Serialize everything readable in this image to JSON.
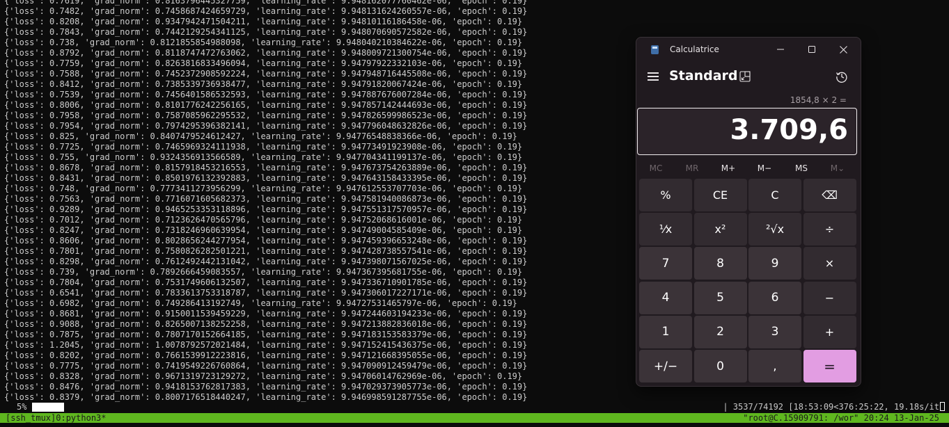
{
  "terminal": {
    "log_lines": [
      "{'loss': 0.7619, 'grad_norm': 0.8163796445327759, 'learning_rate': 9.948162077760462e-06, 'epoch': 0.19}",
      "{'loss': 0.7482, 'grad_norm': 0.7458687424659729, 'learning_rate': 9.948131624260557e-06, 'epoch': 0.19}",
      "{'loss': 0.8208, 'grad_norm': 0.9347942471504211, 'learning_rate': 9.94810116186458e-06, 'epoch': 0.19}",
      "{'loss': 0.7843, 'grad_norm': 0.7442129254341125, 'learning_rate': 9.948070690572582e-06, 'epoch': 0.19}",
      "{'loss': 0.738, 'grad_norm': 0.8121855854988098, 'learning_rate': 9.948040210384622e-06, 'epoch': 0.19}",
      "{'loss': 0.8792, 'grad_norm': 0.8118747472763062, 'learning_rate': 9.948009721300754e-06, 'epoch': 0.19}",
      "{'loss': 0.7759, 'grad_norm': 0.8263816833496094, 'learning_rate': 9.94797922332103e-06, 'epoch': 0.19}",
      "{'loss': 0.7588, 'grad_norm': 0.7452372908592224, 'learning_rate': 9.947948716445508e-06, 'epoch': 0.19}",
      "{'loss': 0.8412, 'grad_norm': 0.7385339736938477, 'learning_rate': 9.94791820067424e-06, 'epoch': 0.19}",
      "{'loss': 0.7539, 'grad_norm': 0.7456401586532593, 'learning_rate': 9.947887676007284e-06, 'epoch': 0.19}",
      "{'loss': 0.8006, 'grad_norm': 0.8101776242256165, 'learning_rate': 9.947857142444693e-06, 'epoch': 0.19}",
      "{'loss': 0.7958, 'grad_norm': 0.7587085962295532, 'learning_rate': 9.947826599986523e-06, 'epoch': 0.19}",
      "{'loss': 0.7954, 'grad_norm': 0.7974295396382141, 'learning_rate': 9.947796048632826e-06, 'epoch': 0.19}",
      "{'loss': 0.825, 'grad_norm': 0.8407479524612427, 'learning_rate': 9.94776548838366e-06, 'epoch': 0.19}",
      "{'loss': 0.7725, 'grad_norm': 0.7465969324111938, 'learning_rate': 9.94773491923908e-06, 'epoch': 0.19}",
      "{'loss': 0.755, 'grad_norm': 0.9324356913566589, 'learning_rate': 9.947704341199137e-06, 'epoch': 0.19}",
      "{'loss': 0.8678, 'grad_norm': 0.8157918453216553, 'learning_rate': 9.947673754263889e-06, 'epoch': 0.19}",
      "{'loss': 0.8431, 'grad_norm': 0.8501976132392883, 'learning_rate': 9.947643158433395e-06, 'epoch': 0.19}",
      "{'loss': 0.748, 'grad_norm': 0.7773411273956299, 'learning_rate': 9.947612553707703e-06, 'epoch': 0.19}",
      "{'loss': 0.7563, 'grad_norm': 0.7716071605682373, 'learning_rate': 9.947581940086873e-06, 'epoch': 0.19}",
      "{'loss': 0.9289, 'grad_norm': 0.9465253353118896, 'learning_rate': 9.947551317570957e-06, 'epoch': 0.19}",
      "{'loss': 0.7012, 'grad_norm': 0.7123626470565796, 'learning_rate': 9.94752068616001e-06, 'epoch': 0.19}",
      "{'loss': 0.8247, 'grad_norm': 0.7318246960639954, 'learning_rate': 9.94749004585409e-06, 'epoch': 0.19}",
      "{'loss': 0.8606, 'grad_norm': 0.8028656244277954, 'learning_rate': 9.947459396653248e-06, 'epoch': 0.19}",
      "{'loss': 0.7801, 'grad_norm': 0.7580826282501221, 'learning_rate': 9.947428738557541e-06, 'epoch': 0.19}",
      "{'loss': 0.8298, 'grad_norm': 0.7612492442131042, 'learning_rate': 9.947398071567025e-06, 'epoch': 0.19}",
      "{'loss': 0.739, 'grad_norm': 0.7892666459083557, 'learning_rate': 9.947367395681755e-06, 'epoch': 0.19}",
      "{'loss': 0.7804, 'grad_norm': 0.7531749606132507, 'learning_rate': 9.947336710901785e-06, 'epoch': 0.19}",
      "{'loss': 0.6541, 'grad_norm': 0.7833613753318787, 'learning_rate': 9.947306017227171e-06, 'epoch': 0.19}",
      "{'loss': 0.6982, 'grad_norm': 0.749286413192749, 'learning_rate': 9.94727531465797e-06, 'epoch': 0.19}",
      "{'loss': 0.8681, 'grad_norm': 0.9150011539459229, 'learning_rate': 9.947244603194233e-06, 'epoch': 0.19}",
      "{'loss': 0.9088, 'grad_norm': 0.8265007138252258, 'learning_rate': 9.947213882836018e-06, 'epoch': 0.19}",
      "{'loss': 0.7875, 'grad_norm': 0.7807170152664185, 'learning_rate': 9.947183153583379e-06, 'epoch': 0.19}",
      "{'loss': 1.2045, 'grad_norm': 1.0078792572021484, 'learning_rate': 9.947152415436375e-06, 'epoch': 0.19}",
      "{'loss': 0.8202, 'grad_norm': 0.7661539912223816, 'learning_rate': 9.947121668395055e-06, 'epoch': 0.19}",
      "{'loss': 0.7775, 'grad_norm': 0.7419549226760864, 'learning_rate': 9.947090912459479e-06, 'epoch': 0.19}",
      "{'loss': 0.8328, 'grad_norm': 0.9671319723129272, 'learning_rate': 9.94706014762969e-06, 'epoch': 0.19}",
      "{'loss': 0.8476, 'grad_norm': 0.9418153762817383, 'learning_rate': 9.947029373905773e-06, 'epoch': 0.19}",
      "{'loss': 0.8379, 'grad_norm': 0.8007176518440247, 'learning_rate': 9.946998591287755e-06, 'epoch': 0.19}"
    ],
    "progress": {
      "percent_label": "5%",
      "fraction": 0.05,
      "stats": "| 3537/74192 [18:53:09<376:25:22, 19.18s/it"
    },
    "tmux": {
      "left": "[ssh_tmux]0:python3*",
      "right": "\"root@C.15909791: /wor\" 20:24 13-Jan-25"
    }
  },
  "calculator": {
    "app_title": "Calculatrice",
    "mode": "Standard",
    "expression": "1854,8 × 2 =",
    "value": "3.709,6",
    "memory": [
      {
        "label": "MC",
        "enabled": false
      },
      {
        "label": "MR",
        "enabled": false
      },
      {
        "label": "M+",
        "enabled": true
      },
      {
        "label": "M−",
        "enabled": true
      },
      {
        "label": "MS",
        "enabled": true
      },
      {
        "label": "M⌄",
        "enabled": false
      }
    ],
    "keys": [
      {
        "label": "%",
        "name": "percent-key",
        "kind": "fn"
      },
      {
        "label": "CE",
        "name": "clear-entry-key",
        "kind": "fn"
      },
      {
        "label": "C",
        "name": "clear-key",
        "kind": "fn"
      },
      {
        "label": "⌫",
        "name": "backspace-key",
        "kind": "fn"
      },
      {
        "label": "¹⁄x",
        "name": "reciprocal-key",
        "kind": "fn"
      },
      {
        "label": "x²",
        "name": "square-key",
        "kind": "fn"
      },
      {
        "label": "²√x",
        "name": "square-root-key",
        "kind": "fn"
      },
      {
        "label": "÷",
        "name": "divide-key",
        "kind": "fn"
      },
      {
        "label": "7",
        "name": "digit-7-key",
        "kind": "num"
      },
      {
        "label": "8",
        "name": "digit-8-key",
        "kind": "num"
      },
      {
        "label": "9",
        "name": "digit-9-key",
        "kind": "num"
      },
      {
        "label": "×",
        "name": "multiply-key",
        "kind": "fn"
      },
      {
        "label": "4",
        "name": "digit-4-key",
        "kind": "num"
      },
      {
        "label": "5",
        "name": "digit-5-key",
        "kind": "num"
      },
      {
        "label": "6",
        "name": "digit-6-key",
        "kind": "num"
      },
      {
        "label": "−",
        "name": "subtract-key",
        "kind": "fn"
      },
      {
        "label": "1",
        "name": "digit-1-key",
        "kind": "num"
      },
      {
        "label": "2",
        "name": "digit-2-key",
        "kind": "num"
      },
      {
        "label": "3",
        "name": "digit-3-key",
        "kind": "num"
      },
      {
        "label": "+",
        "name": "add-key",
        "kind": "fn"
      },
      {
        "label": "+/−",
        "name": "negate-key",
        "kind": "num"
      },
      {
        "label": "0",
        "name": "digit-0-key",
        "kind": "num"
      },
      {
        "label": ",",
        "name": "decimal-key",
        "kind": "num"
      },
      {
        "label": "=",
        "name": "equals-key",
        "kind": "equals"
      }
    ],
    "icons": {
      "app": "calculator-icon",
      "menu": "hamburger-icon",
      "keep_on_top": "keep-on-top-icon",
      "history": "history-icon",
      "minimize": "minimize-icon",
      "maximize": "maximize-icon",
      "close": "close-icon"
    },
    "colors": {
      "accent": "#e29de2",
      "background": "#201a1f"
    }
  }
}
